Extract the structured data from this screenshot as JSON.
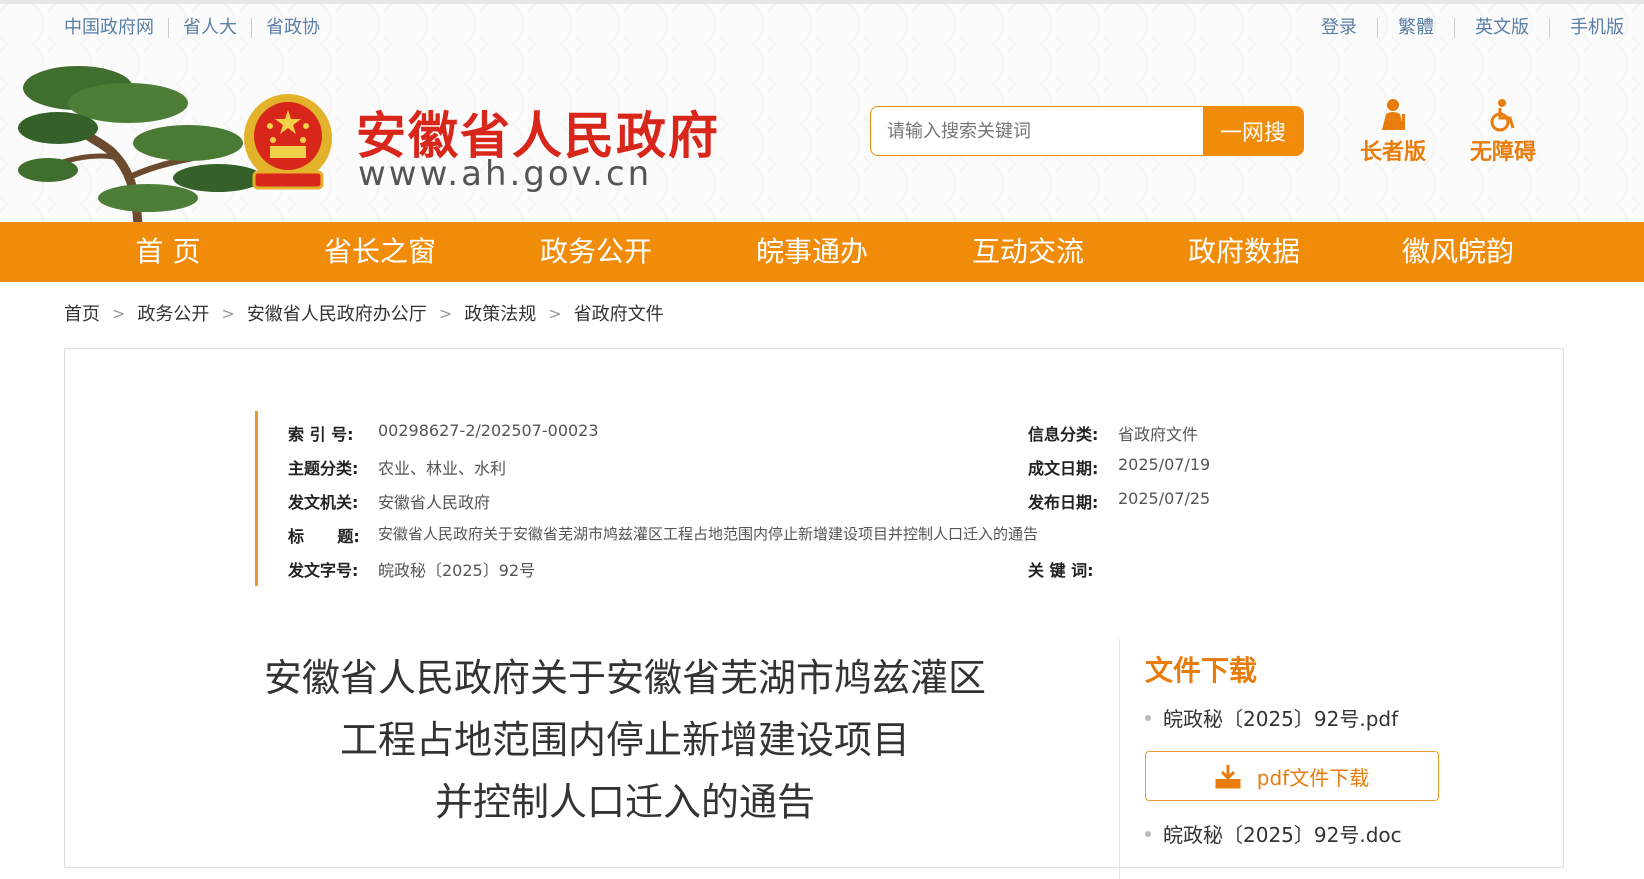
{
  "top_links_left": [
    "中国政府网",
    "省人大",
    "省政协"
  ],
  "top_links_right": [
    "登录",
    "繁體",
    "英文版",
    "手机版"
  ],
  "site": {
    "title": "安徽省人民政府",
    "url": "www.ah.gov.cn"
  },
  "search": {
    "placeholder": "请输入搜索关键词",
    "button": "一网搜"
  },
  "modes": {
    "elder": "长者版",
    "accessible": "无障碍"
  },
  "nav": [
    "首 页",
    "省长之窗",
    "政务公开",
    "皖事通办",
    "互动交流",
    "政府数据",
    "徽风皖韵"
  ],
  "breadcrumb": [
    "首页",
    "政务公开",
    "安徽省人民政府办公厅",
    "政策法规",
    "省政府文件"
  ],
  "meta": {
    "index_key": "索 引 号:",
    "index_val": "00298627-2/202507-00023",
    "info_key": "信息分类:",
    "info_val": "省政府文件",
    "topic_key": "主题分类:",
    "topic_val": "农业、林业、水利",
    "created_key": "成文日期:",
    "created_val": "2025/07/19",
    "issuer_key": "发文机关:",
    "issuer_val": "安徽省人民政府",
    "published_key": "发布日期:",
    "published_val": "2025/07/25",
    "title_key": "标      题:",
    "title_val": "安徽省人民政府关于安徽省芜湖市鸠兹灌区工程占地范围内停止新增建设项目并控制人口迁入的通告",
    "docno_key": "发文字号:",
    "docno_val": "皖政秘〔2025〕92号",
    "keywords_key": "关 键 词:"
  },
  "document": {
    "title_line1": "安徽省人民政府关于安徽省芜湖市鸠兹灌区",
    "title_line2": "工程占地范围内停止新增建设项目",
    "title_line3": "并控制人口迁入的通告"
  },
  "download": {
    "heading": "文件下载",
    "file_pdf": "皖政秘〔2025〕92号.pdf",
    "button_pdf": "pdf文件下载",
    "file_doc": "皖政秘〔2025〕92号.doc"
  },
  "colors": {
    "accent": "#f08c0a",
    "title_red": "#d8261b",
    "link_blue": "#5b7fa6"
  }
}
